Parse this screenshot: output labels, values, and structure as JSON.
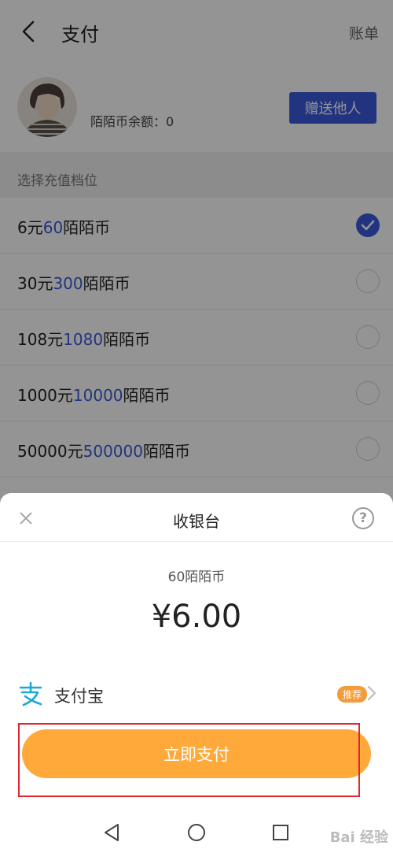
{
  "header": {
    "title": "支付",
    "bill_label": "账单"
  },
  "profile": {
    "balance_label": "陌陌币余额：",
    "balance_value": "0",
    "gift_button": "赠送他人"
  },
  "section": {
    "label": "选择充值档位"
  },
  "options": [
    {
      "price": "6元",
      "coins": "60",
      "unit": "陌陌币",
      "checked": true
    },
    {
      "price": "30元",
      "coins": "300",
      "unit": "陌陌币",
      "checked": false
    },
    {
      "price": "108元",
      "coins": "1080",
      "unit": "陌陌币",
      "checked": false
    },
    {
      "price": "1000元",
      "coins": "10000",
      "unit": "陌陌币",
      "checked": false
    },
    {
      "price": "50000元",
      "coins": "500000",
      "unit": "陌陌币",
      "checked": false
    }
  ],
  "cashier": {
    "title": "收银台",
    "product": "60陌陌币",
    "amount": "¥6.00",
    "method": {
      "name": "支付宝",
      "badge": "推荐"
    },
    "pay_button": "立即支付"
  },
  "colors": {
    "accent": "#3b5bdb",
    "pay_button": "#fea93a",
    "alipay": "#1aa8d9",
    "highlight": "#e0262c",
    "badge": "#f39c3d"
  },
  "icons": [
    "back-icon",
    "avatar",
    "check-icon",
    "close-icon",
    "help-icon",
    "alipay-icon",
    "chevron-right-icon",
    "nav-back-icon",
    "nav-home-icon",
    "nav-recent-icon"
  ],
  "watermark": "Bai 经验"
}
